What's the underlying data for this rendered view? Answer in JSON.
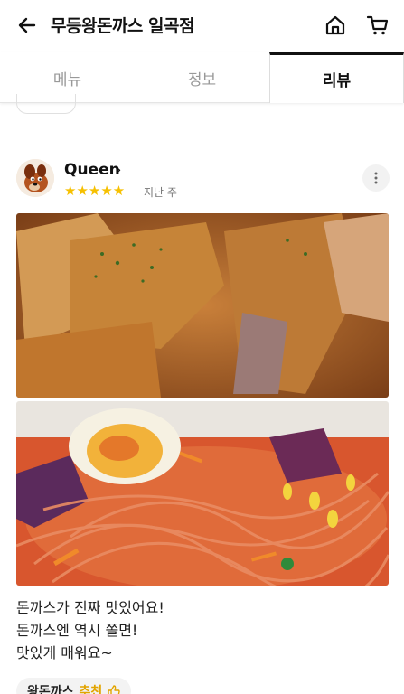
{
  "header": {
    "title": "무등왕돈까스 일곡점"
  },
  "tabs": [
    {
      "label": "메뉴"
    },
    {
      "label": "정보"
    },
    {
      "label": "리뷰"
    }
  ],
  "review": {
    "reviewer_name": "Queen",
    "stars": "★★★★★",
    "rating": 5,
    "time": "지난 주",
    "lines": [
      "돈까스가 진짜 맛있어요!",
      "돈까스엔 역시 쫄면!",
      "맛있게 매워요~"
    ],
    "menu_chip": {
      "name": "왕돈까스",
      "tag": "추천"
    }
  },
  "colors": {
    "star": "#f6c000",
    "recommend": "#e2a400",
    "active_tab_border": "#111111"
  },
  "icons": {
    "back": "arrow-left-icon",
    "home": "home-icon",
    "cart": "cart-icon",
    "more": "more-vertical-icon",
    "thumb": "thumbs-up-icon"
  }
}
